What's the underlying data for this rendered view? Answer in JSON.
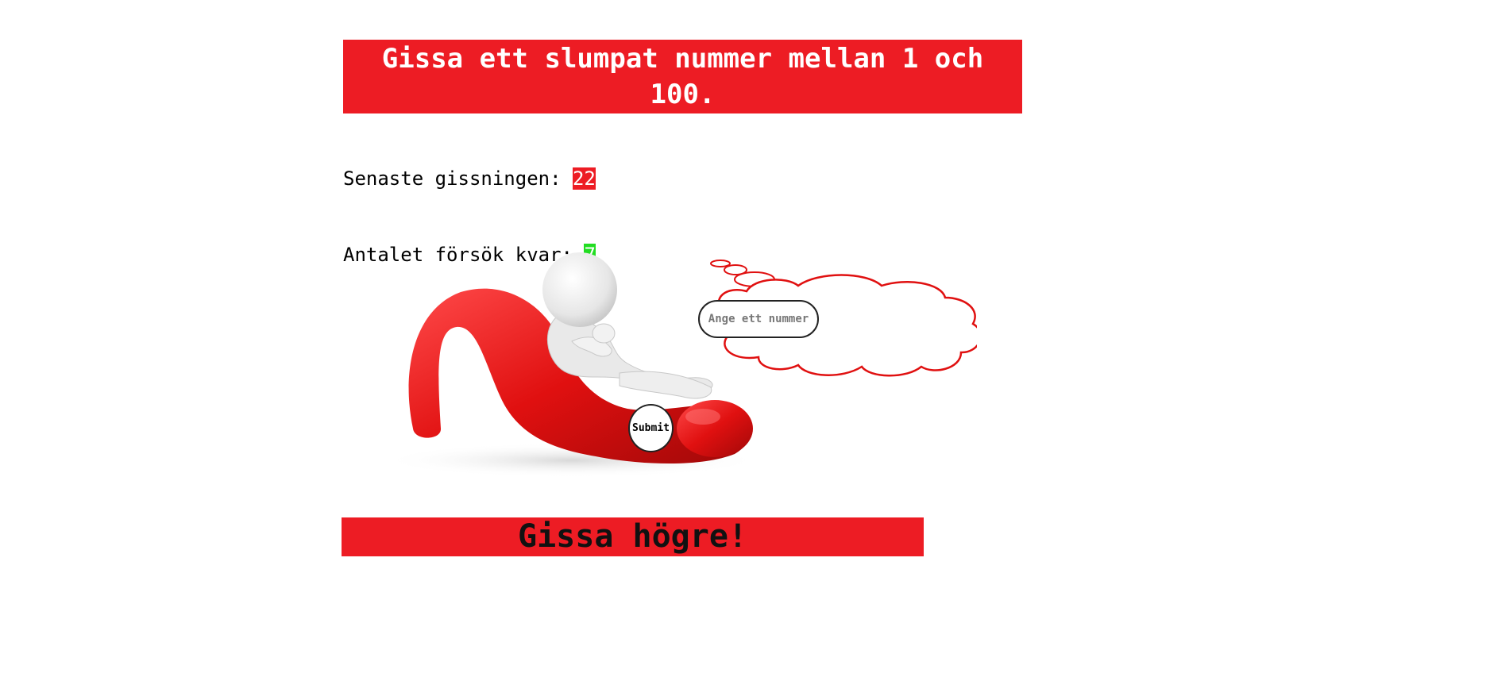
{
  "header": {
    "title": "Gissa ett slumpat nummer mellan 1 och 100."
  },
  "stats": {
    "last_guess_label": "Senaste gissningen: ",
    "last_guess_value": "22",
    "attempts_left_label": "Antalet försök kvar: ",
    "attempts_left_value": "7"
  },
  "form": {
    "input_placeholder": "Ange ett nummer",
    "input_value": "",
    "submit_label": "Submit"
  },
  "result": {
    "message": "Gissa högre!"
  },
  "colors": {
    "accent_red": "#ed1c24",
    "status_green": "#22dd22",
    "background": "#ffffff"
  },
  "icons": {
    "illustration": "thinking-person-on-question-mark",
    "thought_bubble": "cloud-thought-bubble"
  }
}
